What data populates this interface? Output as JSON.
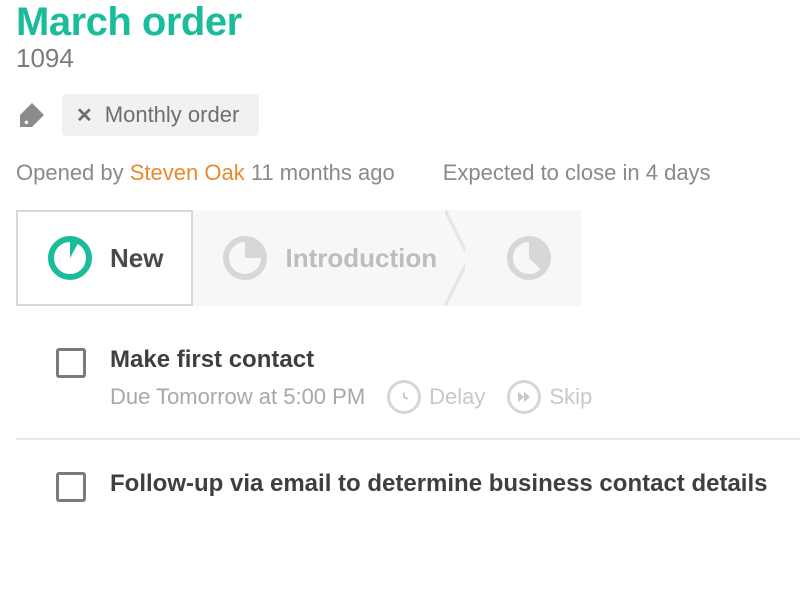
{
  "title": "March order",
  "order_number": "1094",
  "tag": {
    "label": "Monthly order"
  },
  "meta": {
    "opened_prefix": "Opened by ",
    "opened_by": "Steven Oak",
    "opened_suffix": " 11 months ago",
    "expected": "Expected to close in 4 days"
  },
  "stages": {
    "s0": "New",
    "s1": "Introduction"
  },
  "tasks": {
    "t0": {
      "title": "Make first contact",
      "due": "Due Tomorrow at 5:00 PM",
      "delay_label": "Delay",
      "skip_label": "Skip"
    },
    "t1": {
      "title": "Follow-up via email to determine business contact details"
    }
  }
}
